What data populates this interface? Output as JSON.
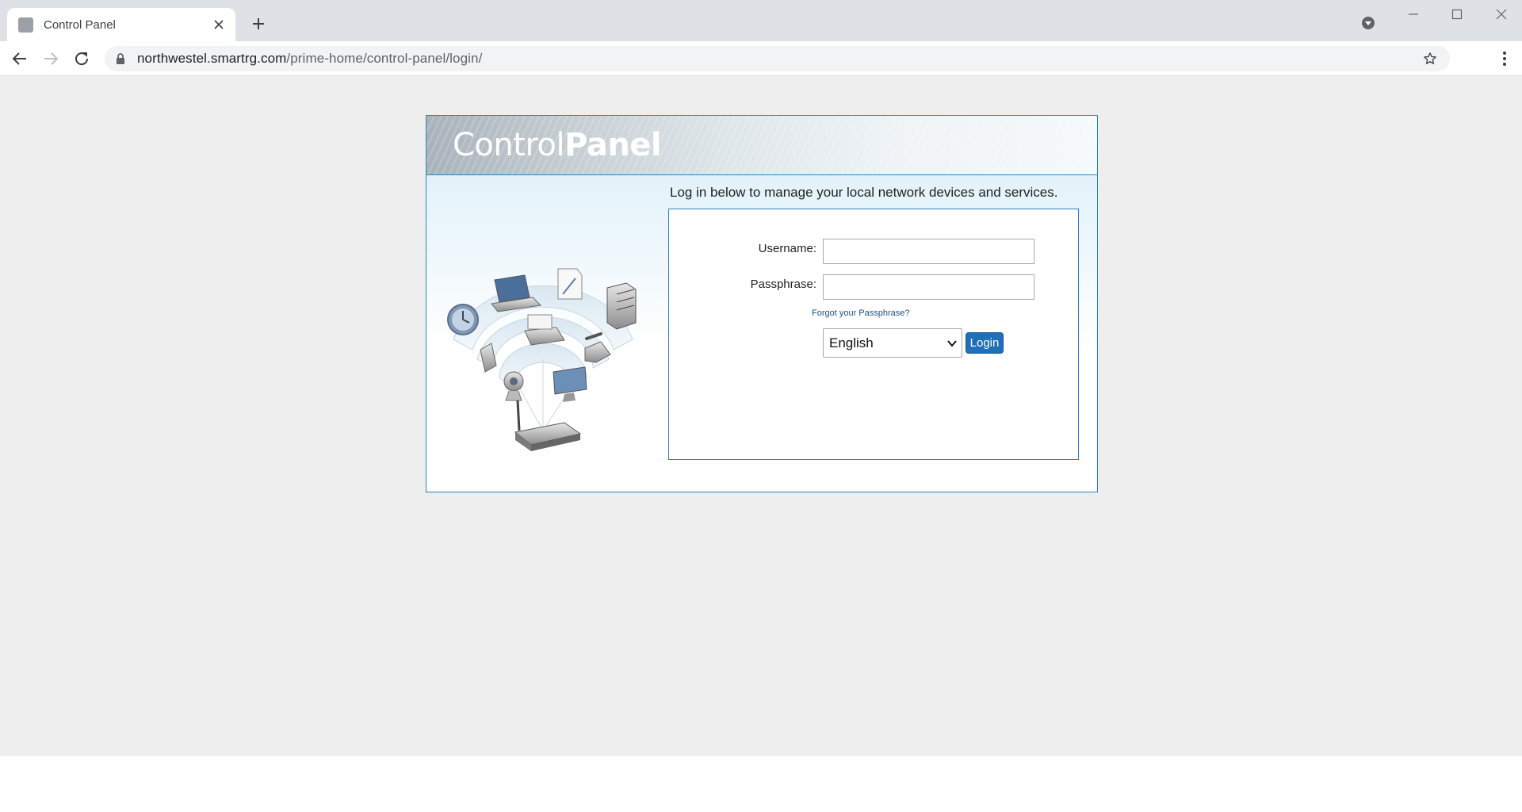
{
  "browser": {
    "tab_title": "Control Panel",
    "url_host": "northwestel.smartrg.com",
    "url_path": "/prime-home/control-panel/login/"
  },
  "page": {
    "brand_light": "Control",
    "brand_bold": "Panel",
    "intro_text": "Log in below to manage your local network devices and services.",
    "form": {
      "username_label": "Username:",
      "username_value": "",
      "passphrase_label": "Passphrase:",
      "passphrase_value": "",
      "forgot_link": "Forgot your Passphrase?",
      "language_selected": "English",
      "login_button": "Login"
    }
  },
  "colors": {
    "accent_border": "#2c83b8",
    "button_blue": "#1f70b8",
    "page_background": "#eeeeee"
  },
  "icons": [
    "tab-favicon",
    "close-icon",
    "plus-icon",
    "back-icon",
    "forward-icon",
    "reload-icon",
    "lock-icon",
    "star-icon",
    "kebab-menu-icon",
    "minimize-icon",
    "maximize-icon",
    "tab-search-icon",
    "chevron-down-icon",
    "network-devices-illustration"
  ]
}
